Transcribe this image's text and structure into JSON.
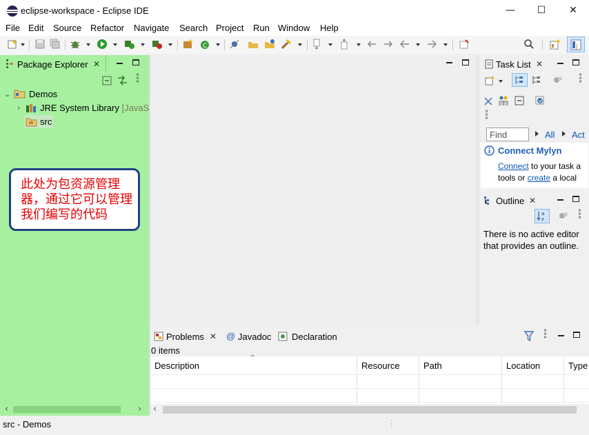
{
  "window": {
    "title": "eclipse-workspace - Eclipse IDE",
    "minimize": "—",
    "maximize": "☐",
    "close": "✕"
  },
  "menu": [
    "File",
    "Edit",
    "Source",
    "Refactor",
    "Navigate",
    "Search",
    "Project",
    "Run",
    "Window",
    "Help"
  ],
  "package_explorer": {
    "tab_label": "Package Explorer",
    "tree": {
      "project": "Demos",
      "library": "JRE System Library",
      "library_suffix": "[JavaSE",
      "source_folder": "src"
    },
    "annotation": "此处为包资源管理器，通过它可以管理我们编写的代码"
  },
  "task_list": {
    "tab_label": "Task List",
    "find_placeholder": "Find",
    "all_label": "All",
    "activate_label": "Act",
    "connect_title": "Connect Mylyn",
    "connect_link": "Connect",
    "connect_text_1": " to your task a",
    "connect_text_2": "tools or ",
    "create_link": "create",
    "connect_text_3": " a local"
  },
  "outline": {
    "tab_label": "Outline",
    "message_line1": "There is no active editor",
    "message_line2": "that provides an outline."
  },
  "problems": {
    "tabs": [
      "Problems",
      "Javadoc",
      "Declaration"
    ],
    "summary": "0 items",
    "columns": [
      "Description",
      "Resource",
      "Path",
      "Location",
      "Type"
    ]
  },
  "status": {
    "selection": "src - Demos"
  },
  "colors": {
    "highlight_panel": "#a6f0a0",
    "annotation_border": "#1f3f84",
    "annotation_text": "#e60000",
    "link": "#0b57b5"
  }
}
